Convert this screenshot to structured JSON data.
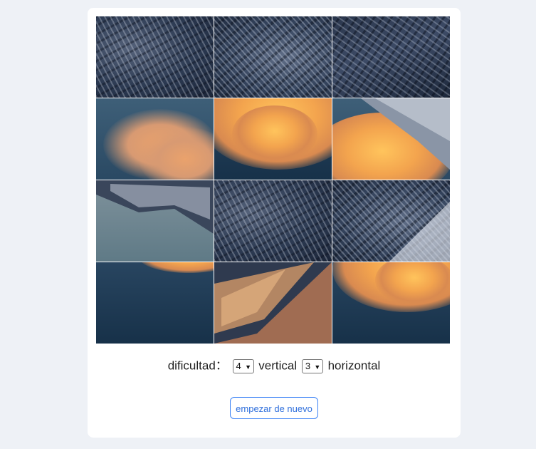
{
  "controls": {
    "difficulty_label": "dificultad：",
    "vertical_value": "4",
    "vertical_label": "vertical",
    "horizontal_value": "3",
    "horizontal_label": "horizontal"
  },
  "restart_button": "empezar de nuevo",
  "puzzle": {
    "rows": 4,
    "cols": 3,
    "tiles": [
      {
        "piece": "rock-ridge-dark"
      },
      {
        "piece": "rock-face-snow"
      },
      {
        "piece": "rock-ridge-right"
      },
      {
        "piece": "cloud-left"
      },
      {
        "piece": "cloud-glow-center"
      },
      {
        "piece": "cloud-peak-right"
      },
      {
        "piece": "ridge-sky-left"
      },
      {
        "piece": "rock-face-center"
      },
      {
        "piece": "snow-slope-right"
      },
      {
        "piece": "sky-dark-left"
      },
      {
        "piece": "sunlit-peak-center"
      },
      {
        "piece": "cloud-glow-right"
      }
    ]
  }
}
